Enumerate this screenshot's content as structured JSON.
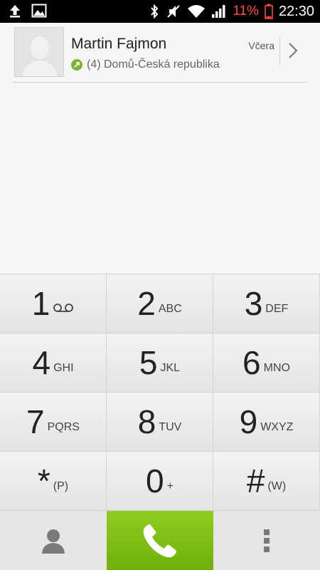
{
  "status_bar": {
    "battery_percent": "11%",
    "time": "22:30"
  },
  "call_log": {
    "entries": [
      {
        "name": "Martin Fajmon",
        "detail": "(4) Domů-Česká republika",
        "date": "Včera"
      }
    ]
  },
  "keypad": {
    "keys": [
      {
        "digit": "1",
        "letters": ""
      },
      {
        "digit": "2",
        "letters": "ABC"
      },
      {
        "digit": "3",
        "letters": "DEF"
      },
      {
        "digit": "4",
        "letters": "GHI"
      },
      {
        "digit": "5",
        "letters": "JKL"
      },
      {
        "digit": "6",
        "letters": "MNO"
      },
      {
        "digit": "7",
        "letters": "PQRS"
      },
      {
        "digit": "8",
        "letters": "TUV"
      },
      {
        "digit": "9",
        "letters": "WXYZ"
      },
      {
        "digit": "*",
        "letters": "(P)"
      },
      {
        "digit": "0",
        "letters": "+"
      },
      {
        "digit": "#",
        "letters": "(W)"
      }
    ]
  },
  "colors": {
    "call_green": "#7fbf14",
    "outgoing_green": "#7bb62c",
    "battery_red": "#ff4a3a"
  },
  "icons": {
    "status_left": [
      "upload-icon",
      "image-icon"
    ],
    "status_right": [
      "bluetooth-icon",
      "mute-icon",
      "wifi-icon",
      "signal-icon",
      "battery-icon"
    ],
    "bottom": [
      "contacts-icon",
      "phone-icon",
      "menu-dots-icon"
    ]
  }
}
